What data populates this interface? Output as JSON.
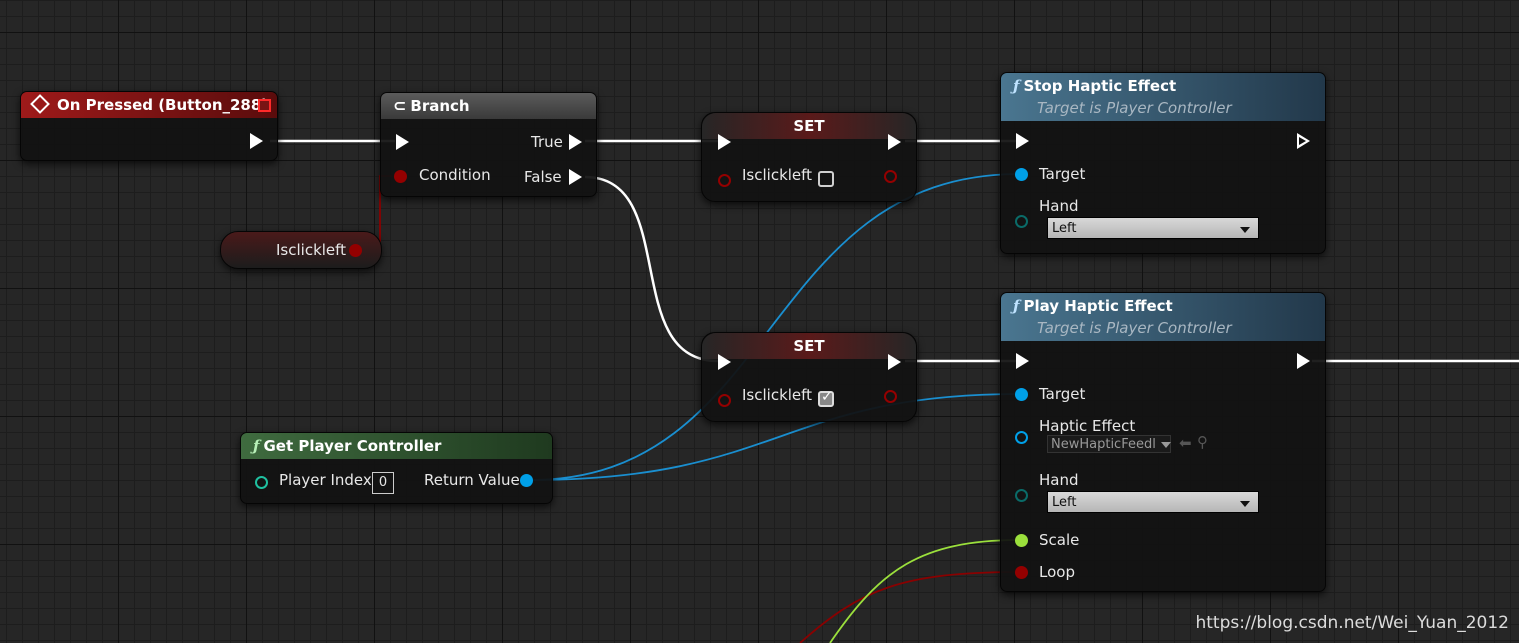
{
  "nodes": {
    "on_pressed": {
      "title": "On Pressed (Button_288)"
    },
    "branch": {
      "title": "Branch",
      "condition_label": "Condition",
      "true_label": "True",
      "false_label": "False"
    },
    "isclickleft_get": {
      "label": "Isclickleft"
    },
    "set1": {
      "title": "SET",
      "var_label": "Isclickleft",
      "checked": false
    },
    "set2": {
      "title": "SET",
      "var_label": "Isclickleft",
      "checked": true
    },
    "get_player_controller": {
      "title": "Get Player Controller",
      "player_index_label": "Player Index",
      "player_index_value": "0",
      "return_label": "Return Value"
    },
    "stop_haptic": {
      "title": "Stop Haptic Effect",
      "subtitle": "Target is Player Controller",
      "target_label": "Target",
      "hand_label": "Hand",
      "hand_value": "Left"
    },
    "play_haptic": {
      "title": "Play Haptic Effect",
      "subtitle": "Target is Player Controller",
      "target_label": "Target",
      "haptic_effect_label": "Haptic Effect",
      "haptic_effect_value": "NewHapticFeedl",
      "hand_label": "Hand",
      "hand_value": "Left",
      "scale_label": "Scale",
      "loop_label": "Loop"
    }
  },
  "colors": {
    "event_header": "#7a1414",
    "function_header": "#2f4e63",
    "pure_header": "#2b4a2b",
    "exec_wire": "#ffffff",
    "object_pin": "#00a0e8",
    "bool_pin": "#940000",
    "float_pin": "#9be03c",
    "byte_pin": "#0a6b68"
  },
  "watermark": "https://blog.csdn.net/Wei_Yuan_2012"
}
